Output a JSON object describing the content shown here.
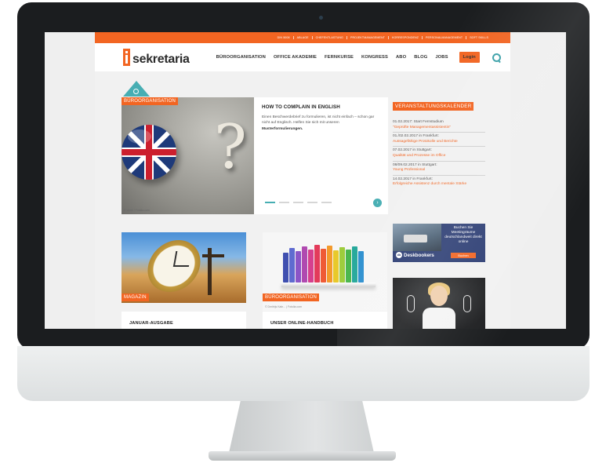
{
  "topbar": {
    "items": [
      "DIN 5008",
      "ABLAGE",
      "CHEFENTLASTUNG",
      "PROJEKTMANAGEMENT",
      "KORRESPONDENZ",
      "PERSONALMANAGEMENT",
      "SOFT SKILLS"
    ]
  },
  "header": {
    "logo_text": "sekretaria",
    "nav": [
      "BÜROORGANISATION",
      "OFFICE AKADEMIE",
      "FERNKURSE",
      "KONGRESS",
      "ABO",
      "BLOG",
      "JOBS"
    ],
    "login_label": "Login"
  },
  "feature": {
    "category": "BÜROORGANISATION",
    "image_credit": "© vinnk / Fotolia.com",
    "title": "HOW TO COMPLAIN IN ENGLISH",
    "body": "Einen Beschwerdebrief zu formulieren, ist nicht einfach – schon gar nicht auf Englisch. Helfen Sie sich mit unseren",
    "body_bold": "Musterformulierungen."
  },
  "calendar": {
    "title": "VERANSTALTUNGSKALENDER",
    "events": [
      {
        "date": "01.02.2017: Start Fernstudium",
        "link": "\"Geprüfte Managementassistentin\""
      },
      {
        "date": "01./02.02.2017 in Frankfurt:",
        "link": "Aussagefähige Protokolle und Berichte"
      },
      {
        "date": "07.02.2017 in Stuttgart:",
        "link": "Qualität und Prozesse im Office"
      },
      {
        "date": "08/09.02.2017 in Stuttgart:",
        "link": "Young Professional"
      },
      {
        "date": "14.02.2017 in Frankfurt:",
        "link": "Erfolgreiche Assistenz durch mentale Stärke"
      }
    ]
  },
  "cards": [
    {
      "category": "MAGAZIN",
      "title": "JANUAR-AUSGABE"
    },
    {
      "category": "BÜROORGANISATION",
      "credit": "© Dmitrijs Kaln... | Fotolia.com",
      "title": "UNSER ONLINE-HANDBUCH"
    }
  ],
  "ads": {
    "deskbookers_text": "Buchen Sie Meetingräume deutschlandweit direkt online",
    "deskbookers_brand": "Deskbookers",
    "deskbookers_button": "Buchen"
  },
  "colors": {
    "accent": "#f26522",
    "teal": "#47aeb3"
  }
}
